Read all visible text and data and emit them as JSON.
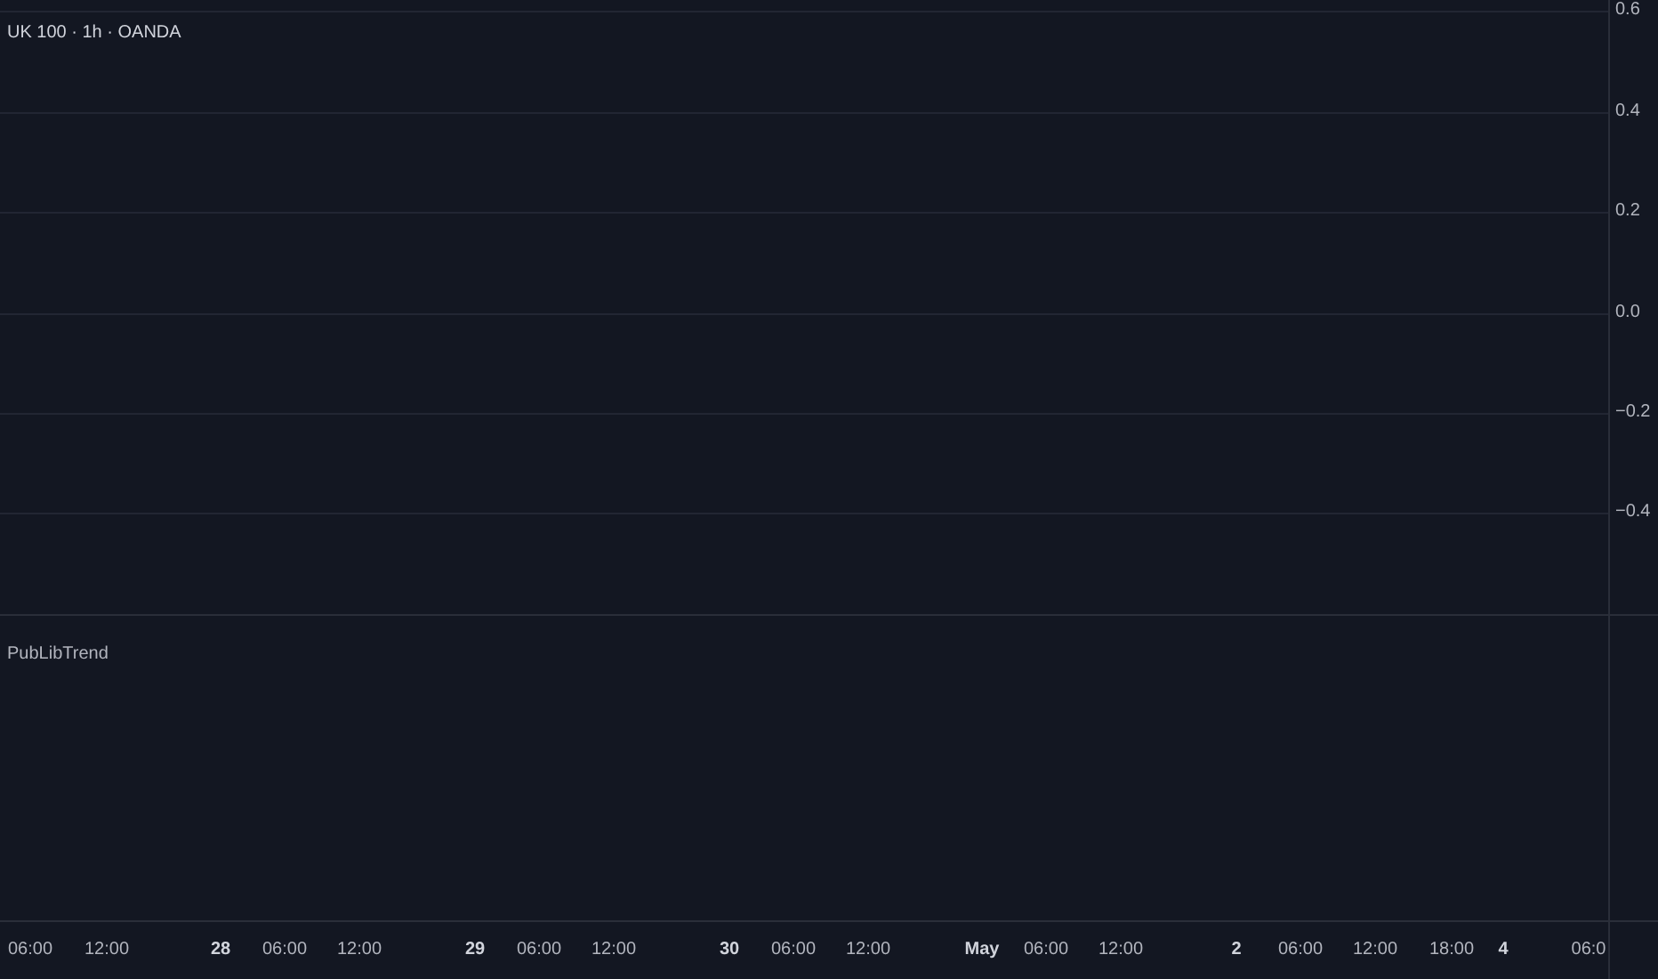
{
  "main_pane": {
    "legend": "UK 100 · 1h · OANDA",
    "price_axis": [
      "0.6",
      "0.4",
      "0.2",
      "0.0",
      "−0.2",
      "−0.4"
    ]
  },
  "indicator_pane": {
    "legend": "PubLibTrend"
  },
  "time_axis": [
    {
      "label": "06:00",
      "kind": "time"
    },
    {
      "label": "12:00",
      "kind": "time"
    },
    {
      "label": "28",
      "kind": "date"
    },
    {
      "label": "06:00",
      "kind": "time"
    },
    {
      "label": "12:00",
      "kind": "time"
    },
    {
      "label": "29",
      "kind": "date"
    },
    {
      "label": "06:00",
      "kind": "time"
    },
    {
      "label": "12:00",
      "kind": "time"
    },
    {
      "label": "30",
      "kind": "date"
    },
    {
      "label": "06:00",
      "kind": "time"
    },
    {
      "label": "12:00",
      "kind": "time"
    },
    {
      "label": "May",
      "kind": "date"
    },
    {
      "label": "06:00",
      "kind": "time"
    },
    {
      "label": "12:00",
      "kind": "time"
    },
    {
      "label": "2",
      "kind": "date"
    },
    {
      "label": "06:00",
      "kind": "time"
    },
    {
      "label": "12:00",
      "kind": "time"
    },
    {
      "label": "18:00",
      "kind": "time"
    },
    {
      "label": "4",
      "kind": "date"
    },
    {
      "label": "06:0",
      "kind": "time"
    }
  ]
}
